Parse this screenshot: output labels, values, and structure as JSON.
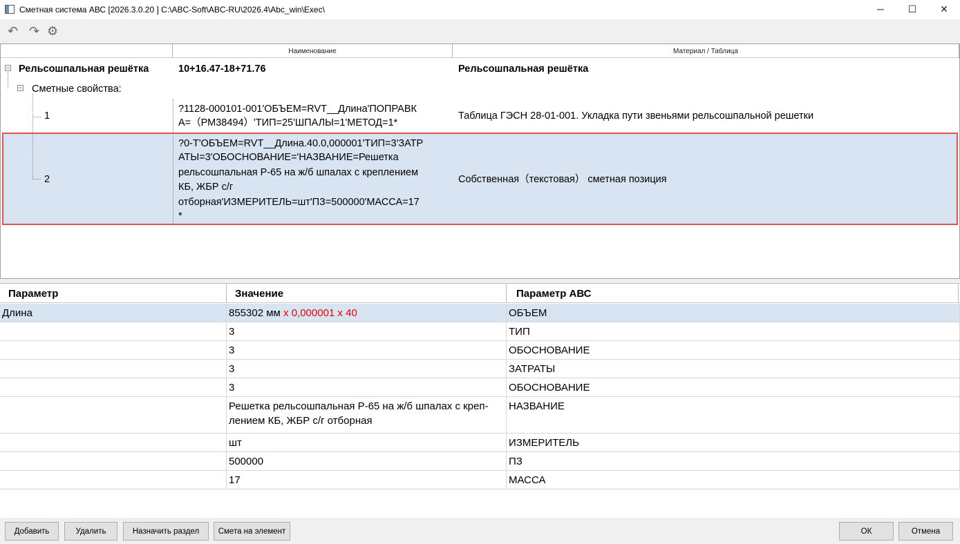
{
  "window": {
    "title": "Сметная система АВС [2026.3.0.20 ]   C:\\ABC-Soft\\ABC-RU\\2026.4\\Abc_win\\Exec\\",
    "minimize": "─",
    "maximize": "☐",
    "close": "✕"
  },
  "toolbar": {
    "undo": "↶",
    "redo": "↷",
    "settings": "⚙"
  },
  "tree": {
    "columns": {
      "name": "Наименование",
      "material": "Материал / Таблица"
    },
    "root": {
      "label": "Рельсошпальная решётка",
      "value": "10+16.47-18+71.76",
      "material": "Рельсошпальная решётка",
      "expander": "−"
    },
    "props": {
      "label": "Сметные свойства:",
      "expander": "−"
    },
    "items": [
      {
        "num": "1",
        "formula_l1": "?1128-000101-001'ОБЪЕМ=RVT__Длина'ПОПРАВК",
        "formula_l2": "А=（РМ38494）'ТИП=25'ШПАЛЫ=1'МЕТОД=1*",
        "material": "Таблица ГЭСН 28-01-001. Укладка пути звеньями рельсошпальной решетки"
      },
      {
        "num": "2",
        "formula_l1": "?0-Т'ОБЪЕМ=RVT__Длина.40.0,000001'ТИП=3'ЗАТР",
        "formula_l2": "АТЫ=3'ОБОСНОВАНИЕ='НАЗВАНИЕ=Решетка",
        "formula_l3": "рельсошпальная Р-65 на ж/б шпалах с креплением",
        "formula_l4": "КБ, ЖБР с/г",
        "formula_l5": "отборная'ИЗМЕРИТЕЛЬ=шт'ПЗ=500000'МАССА=17",
        "formula_l6": "*",
        "material": "Собственная（текстовая） сметная позиция"
      }
    ]
  },
  "grid": {
    "headers": {
      "param": "Параметр",
      "value": "Значение",
      "abc": "Параметр АВС"
    },
    "rows": [
      {
        "param": "Длина",
        "value": "855302 мм",
        "value_red": "х  0,000001 х 40",
        "abc": "ОБЪЕМ"
      },
      {
        "param": "",
        "value": "3",
        "abc": "ТИП"
      },
      {
        "param": "",
        "value": "3",
        "abc": "ОБОСНОВАНИЕ"
      },
      {
        "param": "",
        "value": "3",
        "abc": "ЗАТРАТЫ"
      },
      {
        "param": "",
        "value": "3",
        "abc": "ОБОСНОВАНИЕ"
      },
      {
        "param": "",
        "value_l1": "Решетка рельсошпальная Р-65 на ж/б шпалах с креп-",
        "value_l2": "лением КБ, ЖБР с/г отборная",
        "abc": "НАЗВАНИЕ"
      },
      {
        "param": "",
        "value": "шт",
        "abc": "ИЗМЕРИТЕЛЬ"
      },
      {
        "param": "",
        "value": "500000",
        "abc": "ПЗ"
      },
      {
        "param": "",
        "value": "17",
        "abc": "МАССА"
      }
    ]
  },
  "buttons": {
    "add": "Добавить",
    "delete": "Удалить",
    "assign": "Назначить раздел",
    "estimate": "Смета на элемент",
    "ok": "ОК",
    "cancel": "Отмена"
  },
  "colors": {
    "selection": "#d8e4f2",
    "highlight_border": "#d9534f",
    "red_text": "#e00000"
  }
}
